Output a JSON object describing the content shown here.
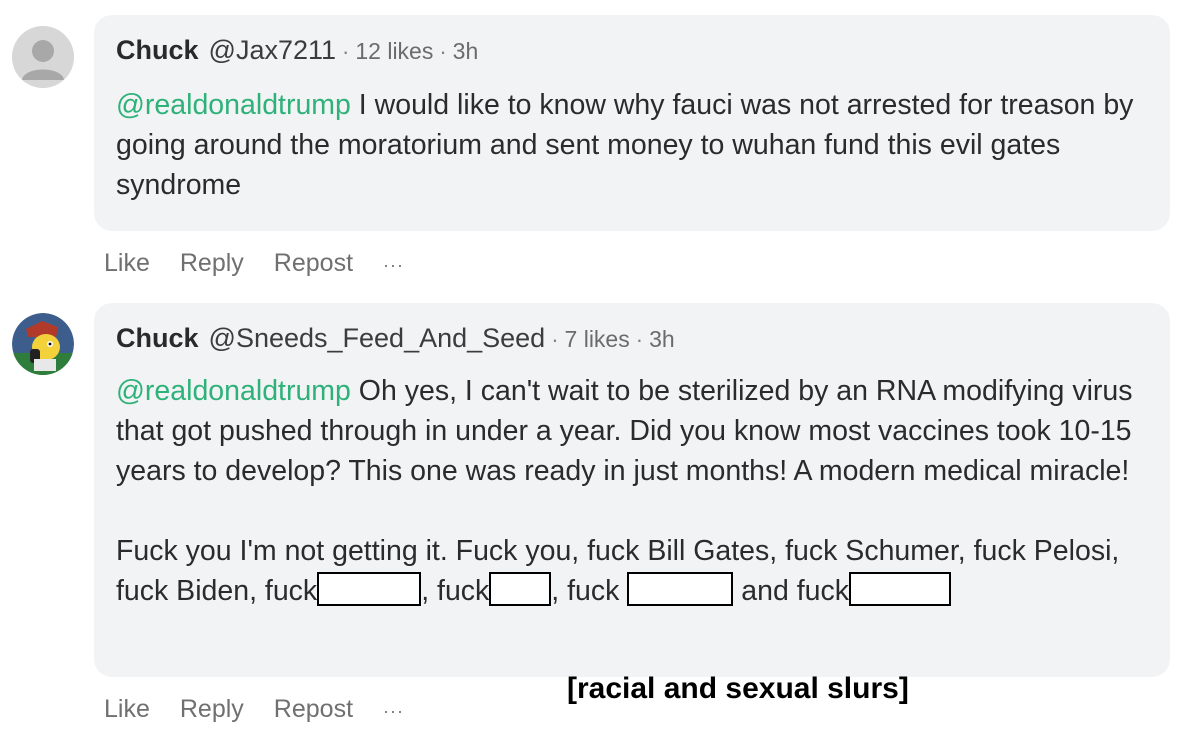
{
  "comments": [
    {
      "name": "Chuck",
      "handle": "@Jax7211",
      "likes": "12 likes",
      "time": "3h",
      "mention": "@realdonaldtrump",
      "text": " I would like to know why fauci was not arrested for treason by going around the moratorium and sent money to wuhan fund this evil gates syndrome",
      "avatar_icon": "default-user-icon",
      "actions": {
        "like": "Like",
        "reply": "Reply",
        "repost": "Repost",
        "more": "···"
      }
    },
    {
      "name": "Chuck",
      "handle": "@Sneeds_Feed_And_Seed",
      "likes": "7 likes",
      "time": "3h",
      "mention": "@realdonaldtrump",
      "text": " Oh yes, I can't wait to be sterilized by an RNA modifying virus that got pushed through in under a year. Did you know most vaccines took 10-15 years to develop? This one was ready in just months! A modern medical miracle!",
      "text2_a": "Fuck you I'm not getting it. Fuck you, fuck Bill Gates, fuck Schumer, fuck Pelosi, fuck Biden, fuck",
      "text2_b": ", fuck",
      "text2_c": ", fuck",
      "text2_d": " and fuck",
      "avatar_icon": "cartoon-avatar-icon",
      "actions": {
        "like": "Like",
        "reply": "Reply",
        "repost": "Repost",
        "more": "···"
      }
    }
  ],
  "caption": "[racial and sexual slurs]",
  "colors": {
    "mention": "#2fb27a",
    "bubble": "#f2f3f5"
  }
}
